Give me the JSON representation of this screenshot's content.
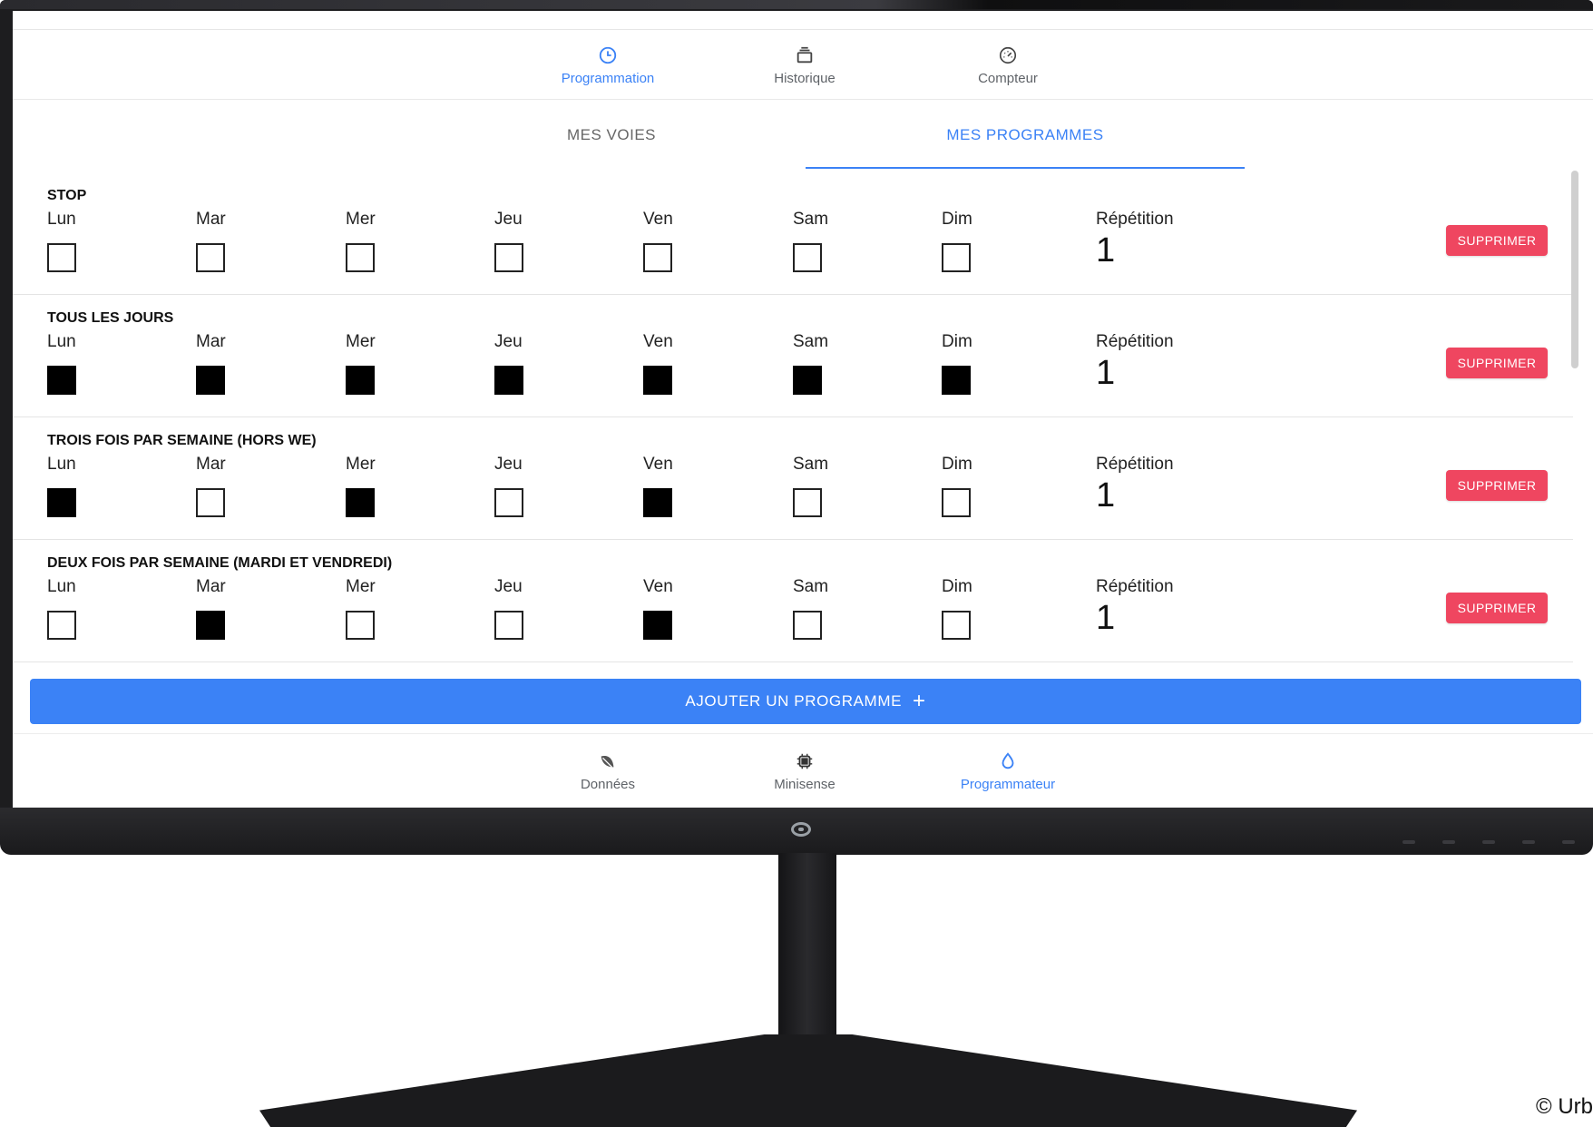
{
  "top_nav": {
    "items": [
      {
        "label": "Programmation",
        "icon": "clock-icon",
        "active": true
      },
      {
        "label": "Historique",
        "icon": "layers-icon",
        "active": false
      },
      {
        "label": "Compteur",
        "icon": "gauge-icon",
        "active": false
      }
    ]
  },
  "tabs": [
    {
      "label": "MES VOIES",
      "active": false
    },
    {
      "label": "MES PROGRAMMES",
      "active": true
    }
  ],
  "days": [
    "Lun",
    "Mar",
    "Mer",
    "Jeu",
    "Ven",
    "Sam",
    "Dim"
  ],
  "repetition_label": "Répétition",
  "delete_label": "SUPPRIMER",
  "programs": [
    {
      "name": "STOP",
      "checked": [
        false,
        false,
        false,
        false,
        false,
        false,
        false
      ],
      "repetition": "1"
    },
    {
      "name": "TOUS LES JOURS",
      "checked": [
        true,
        true,
        true,
        true,
        true,
        true,
        true
      ],
      "repetition": "1"
    },
    {
      "name": "TROIS FOIS PAR SEMAINE (HORS WE)",
      "checked": [
        true,
        false,
        true,
        false,
        true,
        false,
        false
      ],
      "repetition": "1"
    },
    {
      "name": "DEUX FOIS PAR SEMAINE (MARDI ET VENDREDI)",
      "checked": [
        false,
        true,
        false,
        false,
        true,
        false,
        false
      ],
      "repetition": "1"
    }
  ],
  "add_program_label": "AJOUTER UN PROGRAMME",
  "bottom_nav": {
    "items": [
      {
        "label": "Données",
        "icon": "leaf-icon",
        "active": false
      },
      {
        "label": "Minisense",
        "icon": "chip-icon",
        "active": false
      },
      {
        "label": "Programmateur",
        "icon": "water-drop-icon",
        "active": true
      }
    ]
  },
  "colors": {
    "accent": "#3b82f6",
    "danger": "#ef4660",
    "text": "#222222",
    "muted": "#5f6368"
  },
  "copyright": "© Urb"
}
